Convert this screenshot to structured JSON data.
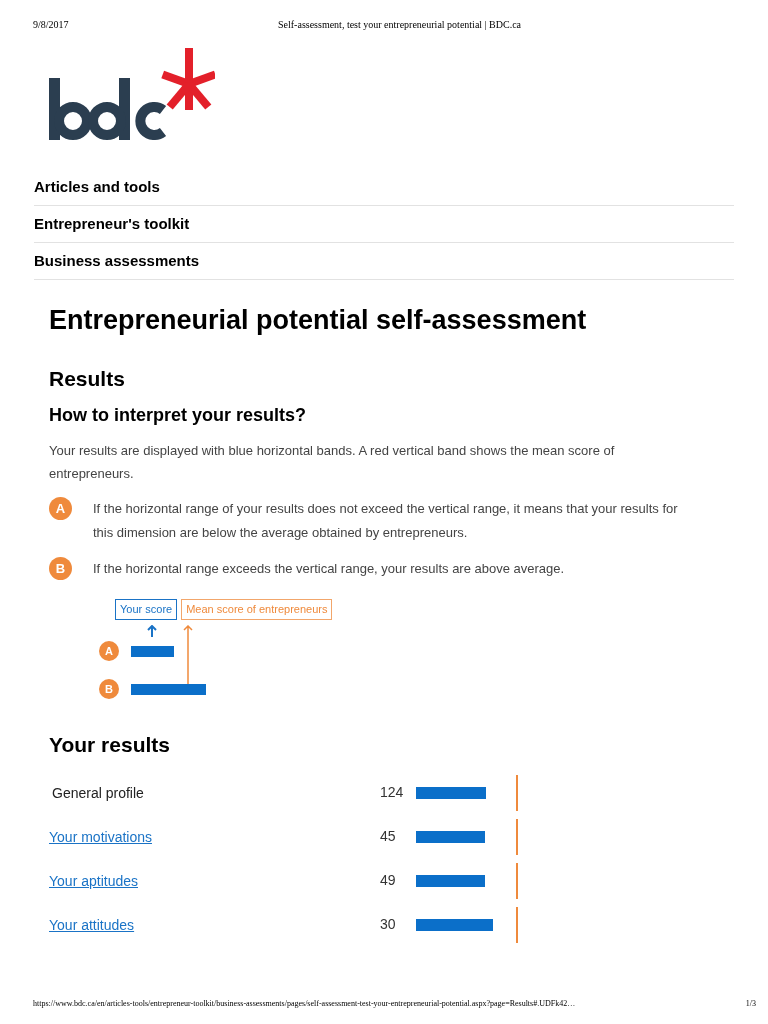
{
  "print_header": {
    "date": "9/8/2017",
    "title": "Self-assessment, test your entrepreneurial potential | BDC.ca"
  },
  "nav": [
    {
      "label": "Articles and tools"
    },
    {
      "label": "Entrepreneur's toolkit"
    },
    {
      "label": "Business assessments"
    }
  ],
  "title": "Entrepreneurial potential self-assessment",
  "results_heading": "Results",
  "interpret_heading": "How to interpret your results?",
  "intro": "Your results are displayed with blue horizontal bands. A red vertical band shows the mean score of entrepreneurs.",
  "explanations": [
    {
      "marker": "A",
      "text": "If the horizontal range of your results does not exceed the vertical range, it means that your results for this dimension are below the average obtained by entrepreneurs."
    },
    {
      "marker": "B",
      "text": "If the horizontal range exceeds the vertical range, your results are above average."
    }
  ],
  "legend": {
    "your_score": "Your score",
    "mean_score": "Mean score of entrepreneurs",
    "examples": [
      {
        "marker": "A"
      },
      {
        "marker": "B"
      }
    ]
  },
  "your_results_heading": "Your results",
  "results": [
    {
      "label": "General profile",
      "kind": "text",
      "score": "124"
    },
    {
      "label": "Your motivations",
      "kind": "link",
      "score": "45"
    },
    {
      "label": "Your aptitudes",
      "kind": "link",
      "score": "49"
    },
    {
      "label": "Your attitudes",
      "kind": "link",
      "score": "30"
    }
  ],
  "print_footer": {
    "url": "https://www.bdc.ca/en/articles-tools/entrepreneur-toolkit/business-assessments/pages/self-assessment-test-your-entrepreneurial-potential.aspx?page=Results#.UDFk42…",
    "page": "1/3"
  }
}
